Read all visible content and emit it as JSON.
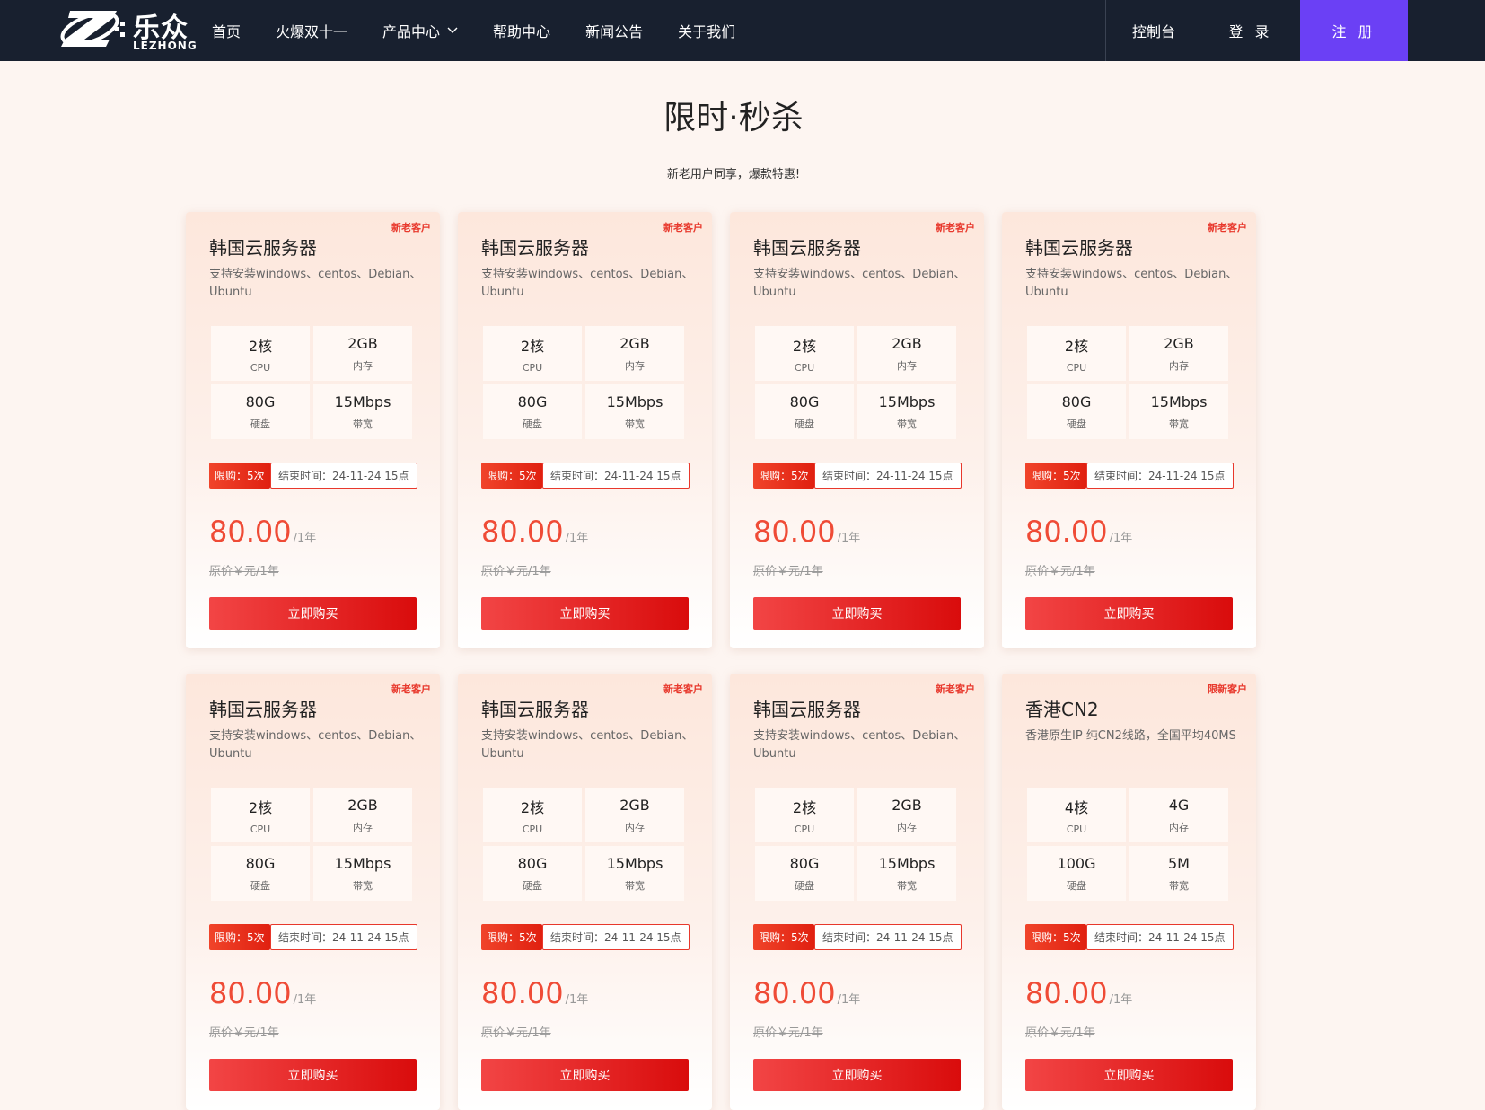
{
  "header": {
    "logo_cn": "乐众",
    "logo_en": "LEZHONG",
    "nav": [
      {
        "label": "首页"
      },
      {
        "label": "火爆双十一"
      },
      {
        "label": "产品中心"
      },
      {
        "label": "帮助中心"
      },
      {
        "label": "新闻公告"
      },
      {
        "label": "关于我们"
      }
    ],
    "console": "控制台",
    "login": "登 录",
    "register": "注 册",
    "accent_color": "#6b40f5"
  },
  "section": {
    "title": "限时·秒杀",
    "subtitle": "新老用户同享，爆款特惠!"
  },
  "cards": [
    {
      "tag": "新老客户",
      "title": "韩国云服务器",
      "desc": "支持安装windows、centos、Debian、Ubuntu",
      "specs": [
        {
          "v": "2核",
          "l": "CPU"
        },
        {
          "v": "2GB",
          "l": "内存"
        },
        {
          "v": "80G",
          "l": "硬盘"
        },
        {
          "v": "15Mbps",
          "l": "带宽"
        }
      ],
      "limit": "限购：5次",
      "end": "结束时间：24-11-24 15点",
      "price": "80.00",
      "price_unit": "/1年",
      "orig": "原价￥元/1年",
      "buy": "立即购买"
    },
    {
      "tag": "新老客户",
      "title": "韩国云服务器",
      "desc": "支持安装windows、centos、Debian、Ubuntu",
      "specs": [
        {
          "v": "2核",
          "l": "CPU"
        },
        {
          "v": "2GB",
          "l": "内存"
        },
        {
          "v": "80G",
          "l": "硬盘"
        },
        {
          "v": "15Mbps",
          "l": "带宽"
        }
      ],
      "limit": "限购：5次",
      "end": "结束时间：24-11-24 15点",
      "price": "80.00",
      "price_unit": "/1年",
      "orig": "原价￥元/1年",
      "buy": "立即购买"
    },
    {
      "tag": "新老客户",
      "title": "韩国云服务器",
      "desc": "支持安装windows、centos、Debian、Ubuntu",
      "specs": [
        {
          "v": "2核",
          "l": "CPU"
        },
        {
          "v": "2GB",
          "l": "内存"
        },
        {
          "v": "80G",
          "l": "硬盘"
        },
        {
          "v": "15Mbps",
          "l": "带宽"
        }
      ],
      "limit": "限购：5次",
      "end": "结束时间：24-11-24 15点",
      "price": "80.00",
      "price_unit": "/1年",
      "orig": "原价￥元/1年",
      "buy": "立即购买"
    },
    {
      "tag": "新老客户",
      "title": "韩国云服务器",
      "desc": "支持安装windows、centos、Debian、Ubuntu",
      "specs": [
        {
          "v": "2核",
          "l": "CPU"
        },
        {
          "v": "2GB",
          "l": "内存"
        },
        {
          "v": "80G",
          "l": "硬盘"
        },
        {
          "v": "15Mbps",
          "l": "带宽"
        }
      ],
      "limit": "限购：5次",
      "end": "结束时间：24-11-24 15点",
      "price": "80.00",
      "price_unit": "/1年",
      "orig": "原价￥元/1年",
      "buy": "立即购买"
    },
    {
      "tag": "新老客户",
      "title": "韩国云服务器",
      "desc": "支持安装windows、centos、Debian、Ubuntu",
      "specs": [
        {
          "v": "2核",
          "l": "CPU"
        },
        {
          "v": "2GB",
          "l": "内存"
        },
        {
          "v": "80G",
          "l": "硬盘"
        },
        {
          "v": "15Mbps",
          "l": "带宽"
        }
      ],
      "limit": "限购：5次",
      "end": "结束时间：24-11-24 15点",
      "price": "80.00",
      "price_unit": "/1年",
      "orig": "原价￥元/1年",
      "buy": "立即购买"
    },
    {
      "tag": "新老客户",
      "title": "韩国云服务器",
      "desc": "支持安装windows、centos、Debian、Ubuntu",
      "specs": [
        {
          "v": "2核",
          "l": "CPU"
        },
        {
          "v": "2GB",
          "l": "内存"
        },
        {
          "v": "80G",
          "l": "硬盘"
        },
        {
          "v": "15Mbps",
          "l": "带宽"
        }
      ],
      "limit": "限购：5次",
      "end": "结束时间：24-11-24 15点",
      "price": "80.00",
      "price_unit": "/1年",
      "orig": "原价￥元/1年",
      "buy": "立即购买"
    },
    {
      "tag": "新老客户",
      "title": "韩国云服务器",
      "desc": "支持安装windows、centos、Debian、Ubuntu",
      "specs": [
        {
          "v": "2核",
          "l": "CPU"
        },
        {
          "v": "2GB",
          "l": "内存"
        },
        {
          "v": "80G",
          "l": "硬盘"
        },
        {
          "v": "15Mbps",
          "l": "带宽"
        }
      ],
      "limit": "限购：5次",
      "end": "结束时间：24-11-24 15点",
      "price": "80.00",
      "price_unit": "/1年",
      "orig": "原价￥元/1年",
      "buy": "立即购买"
    },
    {
      "tag": "限新客户",
      "title": "香港CN2",
      "desc": "香港原生IP 纯CN2线路，全国平均40MS",
      "specs": [
        {
          "v": "4核",
          "l": "CPU"
        },
        {
          "v": "4G",
          "l": "内存"
        },
        {
          "v": "100G",
          "l": "硬盘"
        },
        {
          "v": "5M",
          "l": "带宽"
        }
      ],
      "limit": "限购：5次",
      "end": "结束时间：24-11-24 15点",
      "price": "80.00",
      "price_unit": "/1年",
      "orig": "原价￥元/1年",
      "buy": "立即购买"
    }
  ]
}
